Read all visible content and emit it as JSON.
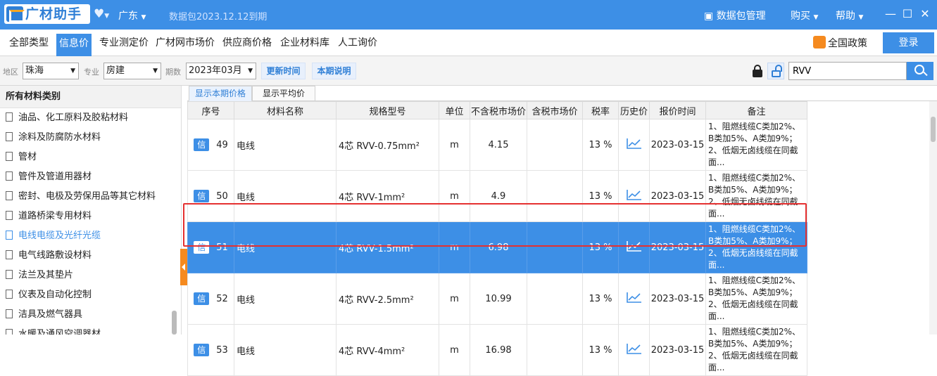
{
  "titlebar": {
    "app_name": "广材助手",
    "region": "广东",
    "expiry": "数据包2023.12.12到期",
    "package_manager": "数据包管理",
    "buy": "购买",
    "help": "帮助",
    "accent_color": "#3d8fe6"
  },
  "nav": {
    "tabs": [
      {
        "label": "全部类型",
        "active": false
      },
      {
        "label": "信息价",
        "active": true
      },
      {
        "label": "专业测定价",
        "active": false
      },
      {
        "label": "广材网市场价",
        "active": false
      },
      {
        "label": "供应商价格",
        "active": false
      },
      {
        "label": "企业材料库",
        "active": false
      },
      {
        "label": "人工询价",
        "active": false
      }
    ],
    "policy": "全国政策",
    "login": "登录"
  },
  "filters": {
    "region_label": "地区",
    "region_value": "珠海",
    "major_label": "专业",
    "major_value": "房建",
    "period_label": "期数",
    "period_value": "2023年03月",
    "update_time": "更新时间",
    "period_note": "本期说明",
    "search_value": "RVV"
  },
  "sidebar": {
    "header": "所有材料类别",
    "items": [
      {
        "label": "油品、化工原料及胶粘材料",
        "active": false
      },
      {
        "label": "涂料及防腐防水材料",
        "active": false
      },
      {
        "label": "管材",
        "active": false
      },
      {
        "label": "管件及管道用器材",
        "active": false
      },
      {
        "label": "密封、电极及劳保用品等其它材料",
        "active": false
      },
      {
        "label": "道路桥梁专用材料",
        "active": false
      },
      {
        "label": "电线电缆及光纤光缆",
        "active": true
      },
      {
        "label": "电气线路敷设材料",
        "active": false
      },
      {
        "label": "法兰及其垫片",
        "active": false
      },
      {
        "label": "仪表及自动化控制",
        "active": false
      },
      {
        "label": "洁具及燃气器具",
        "active": false
      },
      {
        "label": "水暖及通风空调器材",
        "active": false
      }
    ]
  },
  "subtabs": [
    "显示本期价格",
    "显示平均价"
  ],
  "table": {
    "columns": [
      "序号",
      "材料名称",
      "规格型号",
      "单位",
      "不含税市场价",
      "含税市场价",
      "税率",
      "历史价",
      "报价时间",
      "备注"
    ],
    "badge": "信",
    "rows": [
      {
        "no": "49",
        "name": "电线",
        "spec": "4芯 RVV-0.75mm²",
        "unit": "m",
        "price_ex": "4.15",
        "price_inc": "",
        "tax": "13 %",
        "date": "2023-03-15",
        "note": "1、阻燃线缆C类加2%、B类加5%、A类加9%；2、低烟无卤线缆在同截面...",
        "selected": false
      },
      {
        "no": "50",
        "name": "电线",
        "spec": "4芯 RVV-1mm²",
        "unit": "m",
        "price_ex": "4.9",
        "price_inc": "",
        "tax": "13 %",
        "date": "2023-03-15",
        "note": "1、阻燃线缆C类加2%、B类加5%、A类加9%；2、低烟无卤线缆在同截面...",
        "selected": false
      },
      {
        "no": "51",
        "name": "电线",
        "spec": "4芯 RVV-1.5mm²",
        "unit": "m",
        "price_ex": "6.98",
        "price_inc": "",
        "tax": "13 %",
        "date": "2023-03-15",
        "note": "1、阻燃线缆C类加2%、B类加5%、A类加9%；2、低烟无卤线缆在同截面...",
        "selected": true
      },
      {
        "no": "52",
        "name": "电线",
        "spec": "4芯 RVV-2.5mm²",
        "unit": "m",
        "price_ex": "10.99",
        "price_inc": "",
        "tax": "13 %",
        "date": "2023-03-15",
        "note": "1、阻燃线缆C类加2%、B类加5%、A类加9%；2、低烟无卤线缆在同截面...",
        "selected": false
      },
      {
        "no": "53",
        "name": "电线",
        "spec": "4芯 RVV-4mm²",
        "unit": "m",
        "price_ex": "16.98",
        "price_inc": "",
        "tax": "13 %",
        "date": "2023-03-15",
        "note": "1、阻燃线缆C类加2%、B类加5%、A类加9%；2、低烟无卤线缆在同截面...",
        "selected": false
      }
    ]
  }
}
